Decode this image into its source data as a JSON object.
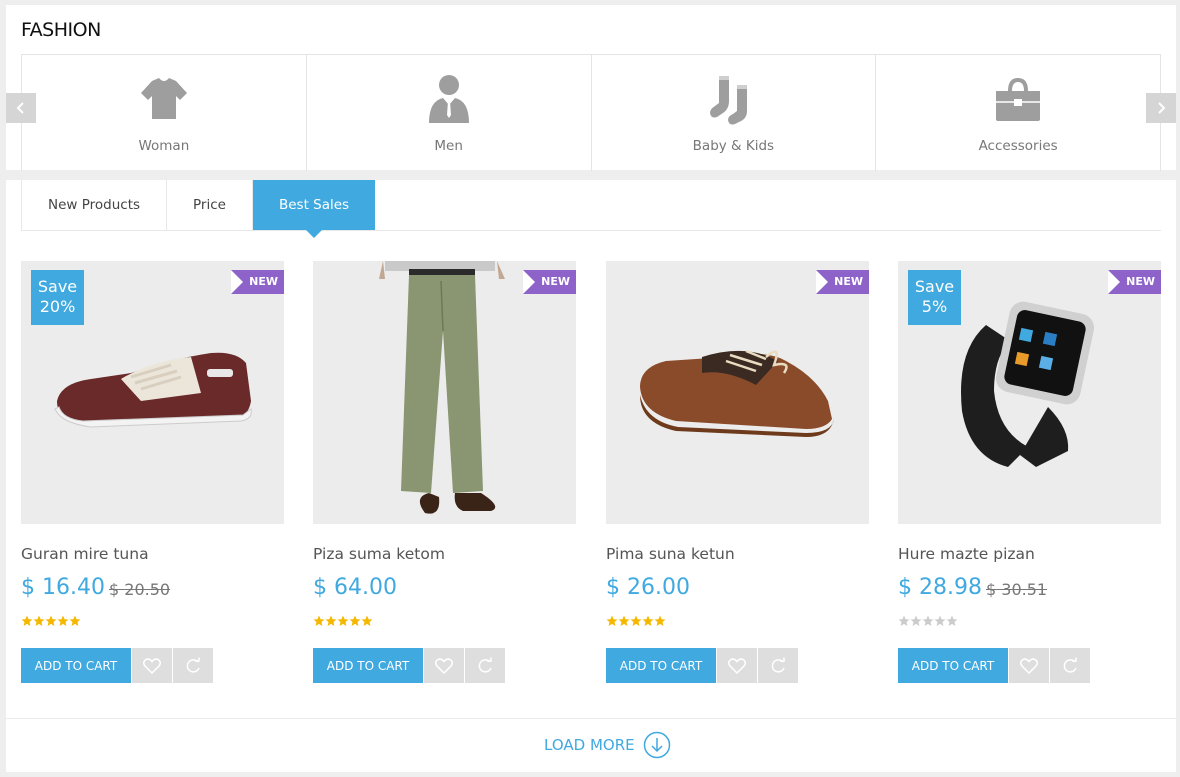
{
  "section": {
    "title": "FASHION"
  },
  "categories": [
    {
      "label": "Woman",
      "icon": "tshirt-icon"
    },
    {
      "label": "Men",
      "icon": "man-icon"
    },
    {
      "label": "Baby & Kids",
      "icon": "socks-icon"
    },
    {
      "label": "Accessories",
      "icon": "handbag-icon"
    }
  ],
  "tabs": [
    {
      "label": "New Products",
      "active": false
    },
    {
      "label": "Price",
      "active": false
    },
    {
      "label": "Best Sales",
      "active": true
    }
  ],
  "products": [
    {
      "name": "Guran mire tuna",
      "price": "$ 16.40",
      "old_price": "$ 20.50",
      "save": "Save\n20%",
      "save_line1": "Save",
      "save_line2": "20%",
      "badge": "NEW",
      "rating": 5,
      "image": "sneaker"
    },
    {
      "name": "Piza suma ketom",
      "price": "$ 64.00",
      "old_price": "",
      "badge": "NEW",
      "rating": 5,
      "image": "trousers"
    },
    {
      "name": "Pima suna ketun",
      "price": "$ 26.00",
      "old_price": "",
      "badge": "NEW",
      "rating": 5,
      "image": "boat-shoe"
    },
    {
      "name": "Hure mazte pizan",
      "price": "$ 28.98",
      "old_price": "$ 30.51",
      "save_line1": "Save",
      "save_line2": "5%",
      "badge": "NEW",
      "rating": 0,
      "image": "smartwatch"
    }
  ],
  "buttons": {
    "add_to_cart": "ADD TO CART",
    "wishlist_icon": "heart-icon",
    "compare_icon": "refresh-icon"
  },
  "load_more": {
    "label": "LOAD MORE"
  },
  "colors": {
    "accent": "#3fa9e0",
    "new_badge": "#8e63c9",
    "star": "#f5b800",
    "star_empty": "#cccccc"
  }
}
